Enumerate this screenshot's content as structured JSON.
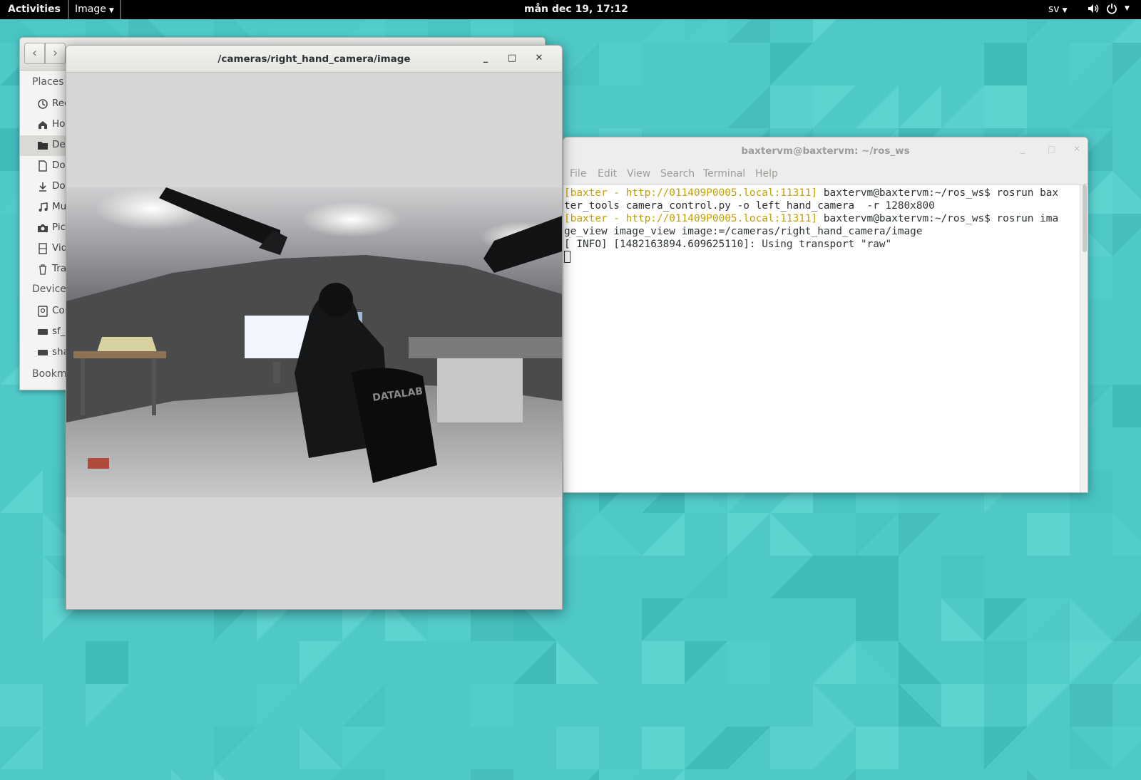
{
  "topbar": {
    "activities_label": "Activities",
    "app_menu_label": "Image",
    "clock": "mån dec 19, 17:12",
    "language": "sv",
    "icons": [
      "volume-icon",
      "power-icon"
    ]
  },
  "files_window": {
    "sidebar": {
      "places_heading": "Places",
      "devices_heading": "Devices",
      "bookmarks_heading": "Bookmarks",
      "places": [
        {
          "label": "Recent",
          "icon": "clock-icon"
        },
        {
          "label": "Home",
          "icon": "home-icon"
        },
        {
          "label": "Desktop",
          "icon": "folder-icon"
        },
        {
          "label": "Documents",
          "icon": "document-icon"
        },
        {
          "label": "Downloads",
          "icon": "download-icon"
        },
        {
          "label": "Music",
          "icon": "music-icon"
        },
        {
          "label": "Pictures",
          "icon": "camera-icon"
        },
        {
          "label": "Videos",
          "icon": "film-icon"
        },
        {
          "label": "Trash",
          "icon": "trash-icon"
        }
      ],
      "devices": [
        {
          "label": "Computer",
          "icon": "harddisk-icon"
        },
        {
          "label": "sf_",
          "icon": "drive-icon"
        },
        {
          "label": "sha",
          "icon": "drive-icon"
        }
      ]
    }
  },
  "image_window": {
    "title": "/cameras/right_hand_camera/image",
    "controls": {
      "minimize": "_",
      "maximize": "□",
      "close": "✕"
    }
  },
  "terminal_window": {
    "title": "baxtervm@baxtervm: ~/ros_ws",
    "menu": [
      "File",
      "Edit",
      "View",
      "Search",
      "Terminal",
      "Help"
    ],
    "lines": [
      {
        "prompt": "[baxter - http://011409P0005.local:11311]",
        "text": " baxtervm@baxtervm:~/ros_ws$ rosrun bax"
      },
      {
        "prompt": "",
        "text": "ter_tools camera_control.py -o left_hand_camera  -r 1280x800"
      },
      {
        "prompt": "[baxter - http://011409P0005.local:11311]",
        "text": " baxtervm@baxtervm:~/ros_ws$ rosrun ima"
      },
      {
        "prompt": "",
        "text": "ge_view image_view image:=/cameras/right_hand_camera/image"
      },
      {
        "prompt": "",
        "text": "[ INFO] [1482163894.609625110]: Using transport \"raw\""
      }
    ]
  },
  "colors": {
    "wallpaper": "#4fc9c8",
    "prompt": "#c4a000",
    "topbar": "#000000"
  }
}
